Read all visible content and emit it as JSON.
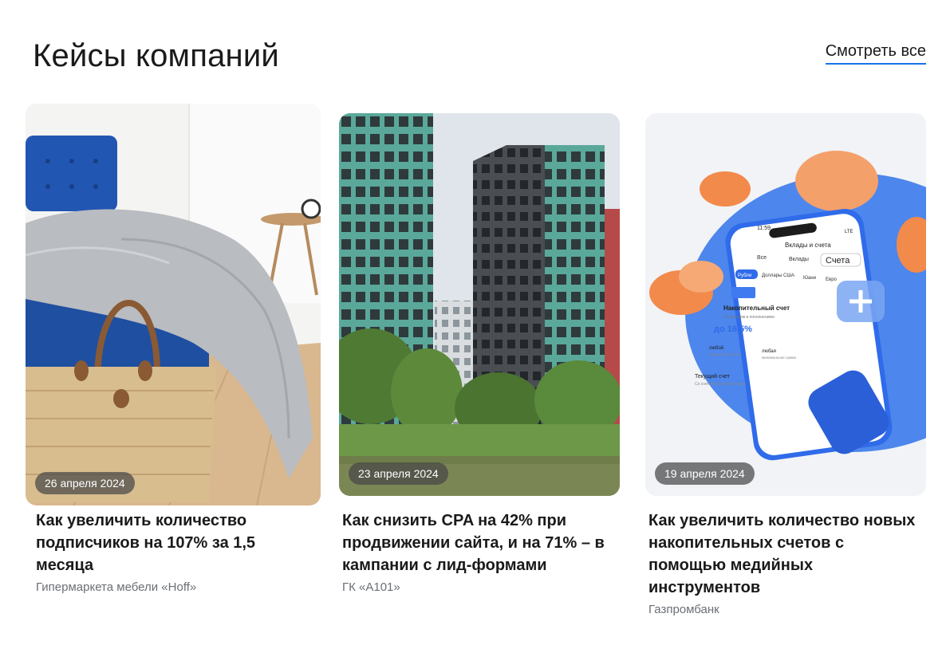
{
  "header": {
    "title": "Кейсы компаний",
    "see_all_label": "Смотреть все"
  },
  "cards": [
    {
      "date": "26 апреля 2024",
      "title": "Как увеличить количество подписчиков на 107% за 1,5 месяца",
      "company": "Гипермаркета мебели «Hoff»"
    },
    {
      "date": "23 апреля 2024",
      "title": "Как снизить CPA на 42% при продвижении сайта, и на 71% – в кампании с лид-формами",
      "company": "ГК «А101»"
    },
    {
      "date": "19 апреля 2024",
      "title": "Как увеличить количество новых накопительных счетов с помощью медийных инструментов",
      "company": "Газпромбанк",
      "phone_screen": {
        "time": "11:59",
        "status": "LTE",
        "screen_title": "Вклады и счета",
        "tabs": [
          "Все",
          "Вклады",
          "Счета"
        ],
        "currencies": [
          "Рубли",
          "Доллары США",
          "Юани",
          "Евро"
        ],
        "product_title": "Накопительный счет",
        "product_sub": "Со снятием и пополнением",
        "rate": "до 16,5%",
        "term_value": "любой",
        "term_label": "минимальный срок",
        "amount_value": "любая",
        "amount_label": "минимальная сумма",
        "current_title": "Текущий счет",
        "current_sub": "Со снятием и пополнением"
      }
    }
  ],
  "colors": {
    "accent": "#1a73e8",
    "bank_blue": "#2f6bea",
    "coin_orange": "#f28a4c",
    "building_teal": "#5aa89a"
  }
}
